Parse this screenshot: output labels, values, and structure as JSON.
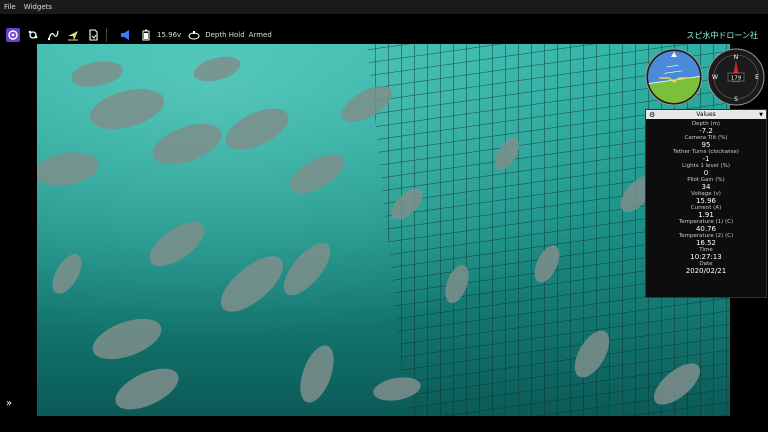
{
  "menu": {
    "file": "File",
    "widgets": "Widgets"
  },
  "toolbar": {
    "voltage": "15.96v",
    "mode": "Depth Hold",
    "state": "Armed"
  },
  "brand": "スピ水中ドローン社",
  "compass": {
    "heading": "179",
    "n": "N",
    "e": "E",
    "s": "S",
    "w": "W"
  },
  "values": {
    "header": "Values",
    "items": [
      {
        "label": "Depth (m)",
        "value": "-7.2"
      },
      {
        "label": "Camera Tilt (%)",
        "value": "95"
      },
      {
        "label": "Tether Turns (clockwise)",
        "value": "-1"
      },
      {
        "label": "Lights 1 level (%)",
        "value": "0"
      },
      {
        "label": "Pilot Gain (%)",
        "value": "34"
      },
      {
        "label": "Voltage (v)",
        "value": "15.96"
      },
      {
        "label": "Current (A)",
        "value": "1.91"
      },
      {
        "label": "Temperature (1) (C)",
        "value": "40.76"
      },
      {
        "label": "Temperature (2) (C)",
        "value": "16.52"
      },
      {
        "label": "Time",
        "value": "10:27:13"
      },
      {
        "label": "Date",
        "value": "2020/02/21"
      }
    ]
  }
}
